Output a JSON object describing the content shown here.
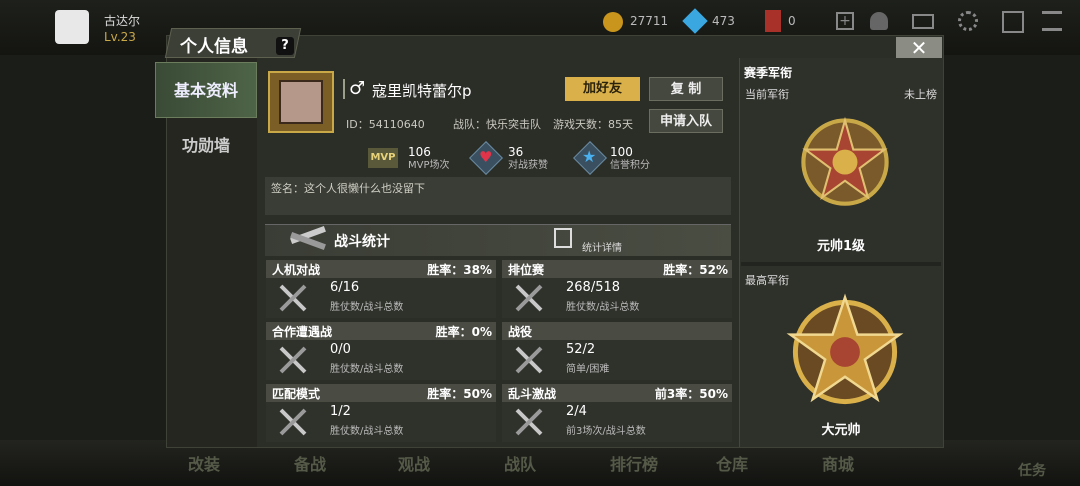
{
  "header": {
    "player_name": "古达尔",
    "level": "Lv.23",
    "gold": "27711",
    "diamonds": "473",
    "tickets": "0"
  },
  "modal": {
    "title": "个人信息",
    "help": "?",
    "close": "✕"
  },
  "sidebar": {
    "tabs": [
      {
        "label": "基本资料"
      },
      {
        "label": "功勋墙"
      }
    ]
  },
  "profile": {
    "name": "寇里凯特蕾尔p",
    "gender_symbol": "♂",
    "add_friend": "加好友",
    "copy": "复 制",
    "apply_team": "申请入队",
    "id_text": "ID：54110640",
    "team_text": "战队：快乐突击队",
    "days_text": "游戏天数：85天",
    "stats": [
      {
        "icon": "MVP",
        "value": "106",
        "label": "MVP场次"
      },
      {
        "icon": "heart",
        "value": "36",
        "label": "对战获赞"
      },
      {
        "icon": "star",
        "value": "100",
        "label": "信誉积分"
      }
    ],
    "signature": "签名：这个人很懒什么也没留下"
  },
  "battle": {
    "title": "战斗统计",
    "detail": "统计详情",
    "cards": [
      {
        "name": "人机对战",
        "rate": "胜率：38%",
        "value": "6/16",
        "label": "胜仗数/战斗总数"
      },
      {
        "name": "排位赛",
        "rate": "胜率：52%",
        "value": "268/518",
        "label": "胜仗数/战斗总数"
      },
      {
        "name": "合作遭遇战",
        "rate": "胜率：0%",
        "value": "0/0",
        "label": "胜仗数/战斗总数"
      },
      {
        "name": "战役",
        "rate": "",
        "value": "52/2",
        "label": "简单/困难"
      },
      {
        "name": "匹配模式",
        "rate": "胜率：50%",
        "value": "1/2",
        "label": "胜仗数/战斗总数"
      },
      {
        "name": "乱斗激战",
        "rate": "前3率：50%",
        "value": "2/4",
        "label": "前3场次/战斗总数"
      }
    ]
  },
  "rank": {
    "section_title": "赛季军衔",
    "current_label": "当前军衔",
    "current_status": "未上榜",
    "current_rank": "元帅1级",
    "highest_label": "最高军衔",
    "highest_rank": "大元帅"
  },
  "bottom_nav": [
    "改装",
    "备战",
    "观战",
    "战队",
    "排行榜",
    "仓库",
    "商城",
    "任务"
  ],
  "colors": {
    "gold_button": "#d9b04a",
    "accent": "#4e6447"
  }
}
